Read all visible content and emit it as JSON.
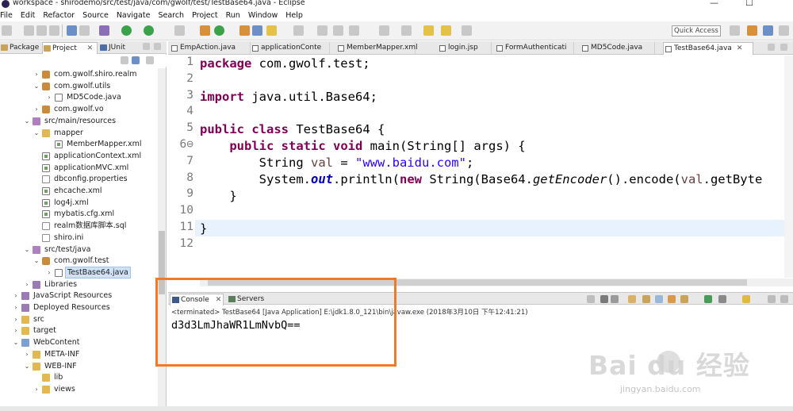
{
  "window": {
    "title": "workspace - shirodemo/src/test/java/com/gwolf/test/TestBase64.java - Eclipse",
    "minimize": "—",
    "maximize": "☐"
  },
  "menu": [
    "File",
    "Edit",
    "Refactor",
    "Source",
    "Navigate",
    "Search",
    "Project",
    "Run",
    "Window",
    "Help"
  ],
  "toolbar": {
    "quick_access": "Quick Access"
  },
  "explorer": {
    "tabs": [
      {
        "label": "Package",
        "active": false
      },
      {
        "label": "Project",
        "active": true
      },
      {
        "label": "JUnit",
        "active": false
      }
    ],
    "tree": [
      {
        "label": "com.gwolf.shiro.realm",
        "icon": "pkg",
        "twisty": "›",
        "indent": 42
      },
      {
        "label": "com.gwolf.utils",
        "icon": "pkg",
        "twisty": "⌄",
        "indent": 42
      },
      {
        "label": "MD5Code.java",
        "icon": "java",
        "twisty": "›",
        "indent": 58
      },
      {
        "label": "com.gwolf.vo",
        "icon": "pkg",
        "twisty": "›",
        "indent": 42
      },
      {
        "label": "src/main/resources",
        "icon": "srcf",
        "twisty": "⌄",
        "indent": 30
      },
      {
        "label": "mapper",
        "icon": "folder",
        "twisty": "⌄",
        "indent": 42
      },
      {
        "label": "MemberMapper.xml",
        "icon": "xml",
        "twisty": "",
        "indent": 58
      },
      {
        "label": "applicationContext.xml",
        "icon": "xml",
        "twisty": "",
        "indent": 42
      },
      {
        "label": "applicationMVC.xml",
        "icon": "xml",
        "twisty": "",
        "indent": 42
      },
      {
        "label": "dbconfig.properties",
        "icon": "file",
        "twisty": "",
        "indent": 42
      },
      {
        "label": "ehcache.xml",
        "icon": "xml",
        "twisty": "",
        "indent": 42
      },
      {
        "label": "log4j.xml",
        "icon": "xml",
        "twisty": "",
        "indent": 42
      },
      {
        "label": "mybatis.cfg.xml",
        "icon": "xml",
        "twisty": "",
        "indent": 42
      },
      {
        "label": "realm数据库脚本.sql",
        "icon": "file",
        "twisty": "",
        "indent": 42
      },
      {
        "label": "shiro.ini",
        "icon": "file",
        "twisty": "",
        "indent": 42
      },
      {
        "label": "src/test/java",
        "icon": "srcf",
        "twisty": "⌄",
        "indent": 30
      },
      {
        "label": "com.gwolf.test",
        "icon": "pkg",
        "twisty": "⌄",
        "indent": 42
      },
      {
        "label": "TestBase64.java",
        "icon": "java",
        "twisty": "›",
        "indent": 58,
        "selected": true
      },
      {
        "label": "Libraries",
        "icon": "lib",
        "twisty": "›",
        "indent": 30
      },
      {
        "label": "JavaScript Resources",
        "icon": "lib",
        "twisty": "›",
        "indent": 16
      },
      {
        "label": "Deployed Resources",
        "icon": "lib",
        "twisty": "›",
        "indent": 16
      },
      {
        "label": "src",
        "icon": "folder",
        "twisty": "›",
        "indent": 16
      },
      {
        "label": "target",
        "icon": "folder",
        "twisty": "›",
        "indent": 16
      },
      {
        "label": "WebContent",
        "icon": "web",
        "twisty": "⌄",
        "indent": 16
      },
      {
        "label": "META-INF",
        "icon": "folder",
        "twisty": "›",
        "indent": 30
      },
      {
        "label": "WEB-INF",
        "icon": "folder",
        "twisty": "⌄",
        "indent": 30
      },
      {
        "label": "lib",
        "icon": "folder",
        "twisty": "",
        "indent": 42
      },
      {
        "label": "views",
        "icon": "folder",
        "twisty": "›",
        "indent": 42
      }
    ]
  },
  "editor": {
    "tabs": [
      {
        "label": "EmpAction.java",
        "active": false
      },
      {
        "label": "applicationConte",
        "active": false
      },
      {
        "label": "MemberMapper.xml",
        "active": false
      },
      {
        "label": "login.jsp",
        "active": false
      },
      {
        "label": "FormAuthenticati",
        "active": false
      },
      {
        "label": "MD5Code.java",
        "active": false
      },
      {
        "label": "TestBase64.java",
        "active": true
      }
    ],
    "line_numbers": [
      "1",
      "2",
      "3",
      "4",
      "5",
      "6⊖",
      "7",
      "8",
      "9",
      "10",
      "11",
      "12"
    ],
    "code": {
      "l1_kw": "package",
      "l1_rest": " com.gwolf.test;",
      "l3_kw": "import",
      "l3_rest": " java.util.Base64;",
      "l5_kw1": "public",
      "l5_kw2": "class",
      "l5_rest": " TestBase64 {",
      "l6_kw1": "public",
      "l6_kw2": "static",
      "l6_kw3": "void",
      "l6_rest": " main(String[] args) {",
      "l7_type": "String ",
      "l7_var": "val",
      "l7_eq": " = ",
      "l7_str": "\"www.baidu.com\"",
      "l7_end": ";",
      "l8_a": "System.",
      "l8_fld": "out",
      "l8_b": ".println(",
      "l8_kw": "new",
      "l8_c": " String(Base64.",
      "l8_it": "getEncoder",
      "l8_d": "().encode(",
      "l8_var": "val",
      "l8_e": ".getByte",
      "l9": "}",
      "l11": "}"
    }
  },
  "console": {
    "tabs": [
      {
        "label": "Console",
        "active": true
      },
      {
        "label": "Servers",
        "active": false
      }
    ],
    "header": "<terminated> TestBase64 [Java Application] E:\\jdk1.8.0_121\\bin\\javaw.exe (2018年3月10日 下午12:41:21)",
    "output": "d3d3LmJhaWR1LmNvbQ=="
  },
  "watermark": {
    "brand": "Bai du 经验",
    "url": "jingyan.baidu.com"
  },
  "colors": {
    "highlight": "#ef7a2a",
    "keyword": "#7f0055",
    "string": "#2a00ff",
    "field": "#0000c0"
  }
}
